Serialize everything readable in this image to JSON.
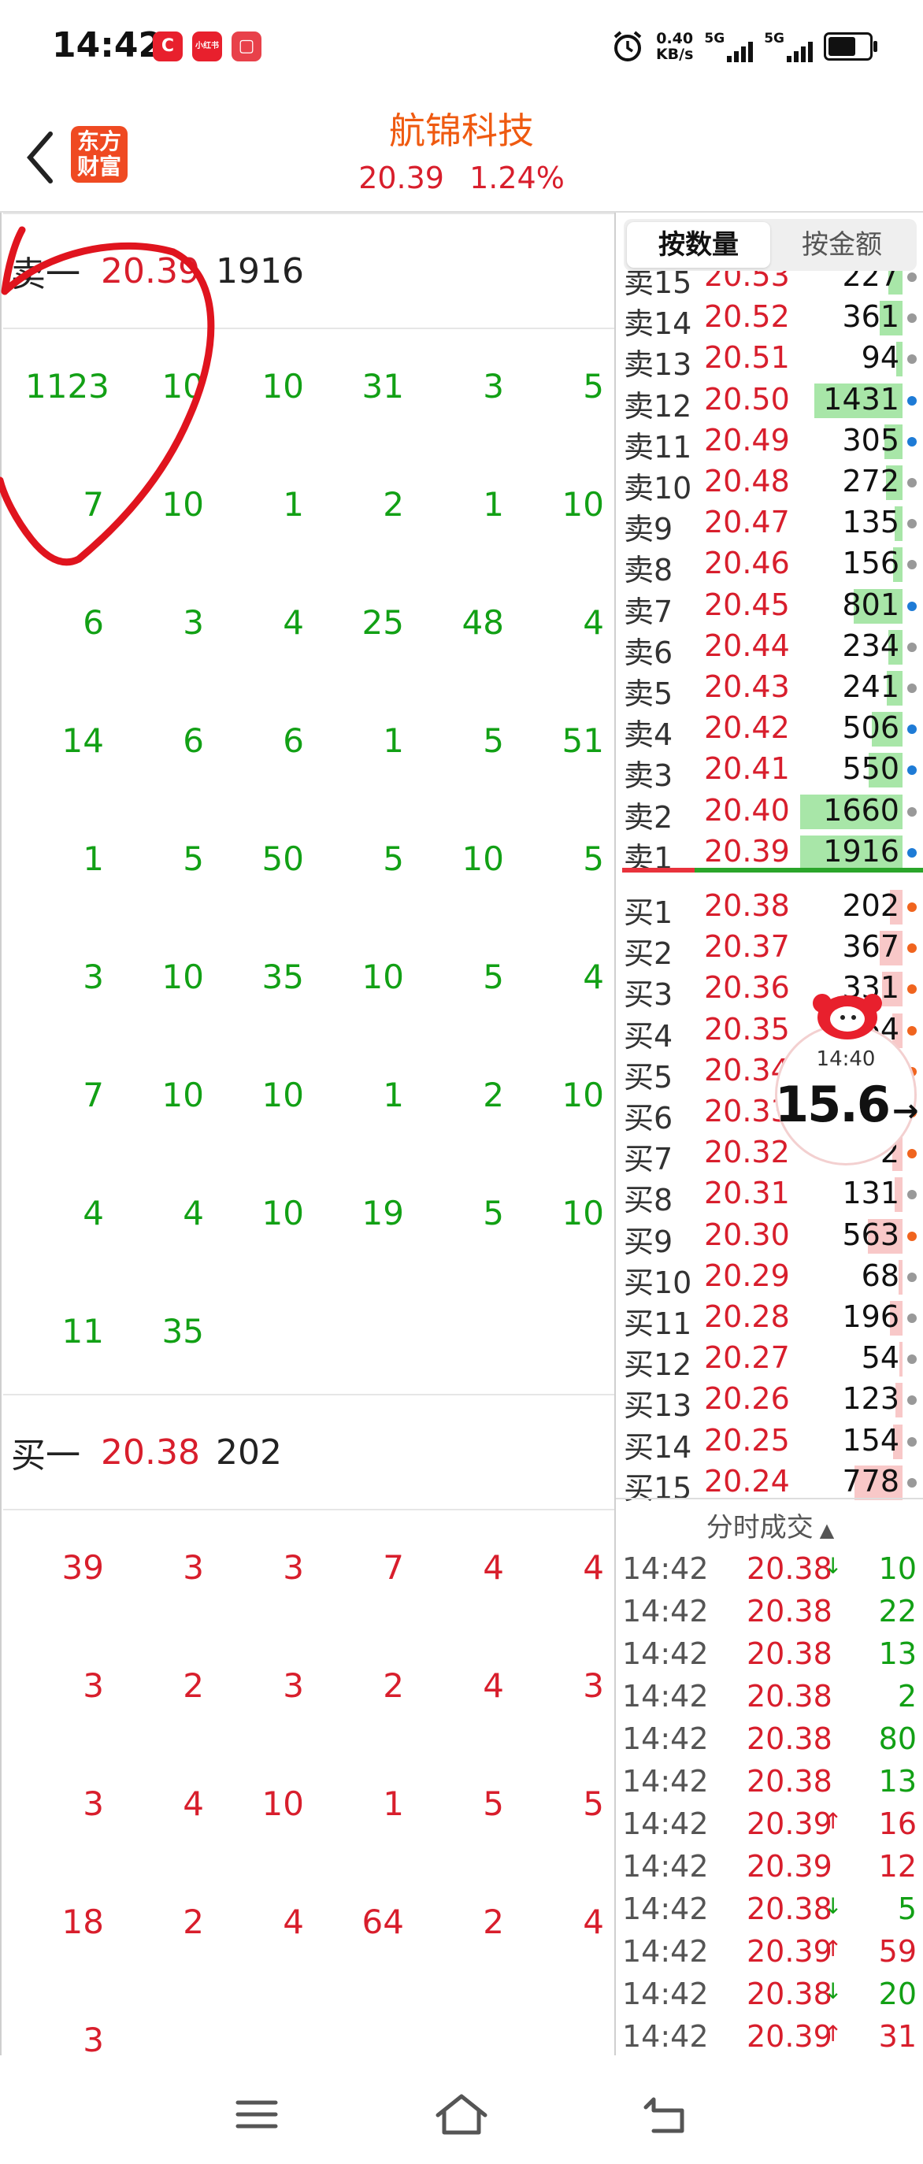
{
  "status_bar": {
    "time": "14:42",
    "apps": [
      {
        "name": "app-c",
        "glyph": "C",
        "color": "#e8202d"
      },
      {
        "name": "app-xiaohongshu",
        "glyph": "小红书",
        "color": "#e8202d"
      },
      {
        "name": "app-red-square",
        "glyph": "▢",
        "color": "#e8414a"
      }
    ],
    "net_speed_value": "0.40",
    "net_speed_unit": "KB/s",
    "signal1": "5G",
    "signal2": "5G"
  },
  "header": {
    "logo_line1": "东方",
    "logo_line2": "财富",
    "stock_name": "航锦科技",
    "price": "20.39",
    "change_pct": "1.24%"
  },
  "sell_section": {
    "label": "卖一",
    "price": "20.39",
    "volume": "1916",
    "orders": [
      [
        "1123",
        "10",
        "10",
        "31",
        "3",
        "5"
      ],
      [
        "7",
        "10",
        "1",
        "2",
        "1",
        "10"
      ],
      [
        "6",
        "3",
        "4",
        "25",
        "48",
        "4"
      ],
      [
        "14",
        "6",
        "6",
        "1",
        "5",
        "51"
      ],
      [
        "1",
        "5",
        "50",
        "5",
        "10",
        "5"
      ],
      [
        "3",
        "10",
        "35",
        "10",
        "5",
        "4"
      ],
      [
        "7",
        "10",
        "10",
        "1",
        "2",
        "10"
      ],
      [
        "4",
        "4",
        "10",
        "19",
        "5",
        "10"
      ],
      [
        "11",
        "35"
      ]
    ]
  },
  "buy_section": {
    "label": "买一",
    "price": "20.38",
    "volume": "202",
    "orders": [
      [
        "39",
        "3",
        "3",
        "7",
        "4",
        "4"
      ],
      [
        "3",
        "2",
        "3",
        "2",
        "4",
        "3"
      ],
      [
        "3",
        "4",
        "10",
        "1",
        "5",
        "5"
      ],
      [
        "18",
        "2",
        "4",
        "64",
        "2",
        "4"
      ],
      [
        "3"
      ]
    ]
  },
  "tabs": {
    "by_quantity": "按数量",
    "by_amount": "按金额"
  },
  "order_book": {
    "sells": [
      {
        "label": "卖15",
        "price": "20.53",
        "volume": "227",
        "bar": 0.14,
        "dot": "#999999"
      },
      {
        "label": "卖14",
        "price": "20.52",
        "volume": "361",
        "bar": 0.22,
        "dot": "#999999"
      },
      {
        "label": "卖13",
        "price": "20.51",
        "volume": "94",
        "bar": 0.06,
        "dot": "#999999"
      },
      {
        "label": "卖12",
        "price": "20.50",
        "volume": "1431",
        "bar": 0.86,
        "dot": "#1e7bd6"
      },
      {
        "label": "卖11",
        "price": "20.49",
        "volume": "305",
        "bar": 0.18,
        "dot": "#1e7bd6"
      },
      {
        "label": "卖10",
        "price": "20.48",
        "volume": "272",
        "bar": 0.16,
        "dot": "#999999"
      },
      {
        "label": "卖9",
        "price": "20.47",
        "volume": "135",
        "bar": 0.08,
        "dot": "#999999"
      },
      {
        "label": "卖8",
        "price": "20.46",
        "volume": "156",
        "bar": 0.09,
        "dot": "#999999"
      },
      {
        "label": "卖7",
        "price": "20.45",
        "volume": "801",
        "bar": 0.48,
        "dot": "#1e7bd6"
      },
      {
        "label": "卖6",
        "price": "20.44",
        "volume": "234",
        "bar": 0.14,
        "dot": "#999999"
      },
      {
        "label": "卖5",
        "price": "20.43",
        "volume": "241",
        "bar": 0.15,
        "dot": "#999999"
      },
      {
        "label": "卖4",
        "price": "20.42",
        "volume": "506",
        "bar": 0.3,
        "dot": "#1e7bd6"
      },
      {
        "label": "卖3",
        "price": "20.41",
        "volume": "550",
        "bar": 0.33,
        "dot": "#1e7bd6"
      },
      {
        "label": "卖2",
        "price": "20.40",
        "volume": "1660",
        "bar": 1.0,
        "dot": "#999999"
      },
      {
        "label": "卖1",
        "price": "20.39",
        "volume": "1916",
        "bar": 1.0,
        "dot": "#1e7bd6"
      }
    ],
    "buys": [
      {
        "label": "买1",
        "price": "20.38",
        "volume": "202",
        "bar": 0.12,
        "dot": "#f0641e"
      },
      {
        "label": "买2",
        "price": "20.37",
        "volume": "367",
        "bar": 0.22,
        "dot": "#f0641e"
      },
      {
        "label": "买3",
        "price": "20.36",
        "volume": "331",
        "bar": 0.2,
        "dot": "#f0641e"
      },
      {
        "label": "买4",
        "price": "20.35",
        "volume": "164",
        "bar": 0.1,
        "dot": "#f0641e"
      },
      {
        "label": "买5",
        "price": "20.34",
        "volume": "",
        "bar": 0.1,
        "dot": "#f0641e"
      },
      {
        "label": "买6",
        "price": "20.33",
        "volume": "",
        "bar": 0.1,
        "dot": "#f0641e"
      },
      {
        "label": "买7",
        "price": "20.32",
        "volume": "2",
        "bar": 0.1,
        "dot": "#f0641e"
      },
      {
        "label": "买8",
        "price": "20.31",
        "volume": "131",
        "bar": 0.08,
        "dot": "#999999"
      },
      {
        "label": "买9",
        "price": "20.30",
        "volume": "563",
        "bar": 0.34,
        "dot": "#f0641e"
      },
      {
        "label": "买10",
        "price": "20.29",
        "volume": "68",
        "bar": 0.04,
        "dot": "#999999"
      },
      {
        "label": "买11",
        "price": "20.28",
        "volume": "196",
        "bar": 0.12,
        "dot": "#999999"
      },
      {
        "label": "买12",
        "price": "20.27",
        "volume": "54",
        "bar": 0.03,
        "dot": "#999999"
      },
      {
        "label": "买13",
        "price": "20.26",
        "volume": "123",
        "bar": 0.07,
        "dot": "#999999"
      },
      {
        "label": "买14",
        "price": "20.25",
        "volume": "154",
        "bar": 0.09,
        "dot": "#999999"
      },
      {
        "label": "买15",
        "price": "20.24",
        "volume": "778",
        "bar": 0.47,
        "dot": "#999999"
      }
    ]
  },
  "ticks": {
    "header": "分时成交",
    "rows": [
      {
        "time": "14:42",
        "price": "20.38",
        "arrow": "down",
        "volume": "10",
        "side": "sell"
      },
      {
        "time": "14:42",
        "price": "20.38",
        "arrow": "",
        "volume": "22",
        "side": "sell"
      },
      {
        "time": "14:42",
        "price": "20.38",
        "arrow": "",
        "volume": "13",
        "side": "sell"
      },
      {
        "time": "14:42",
        "price": "20.38",
        "arrow": "",
        "volume": "2",
        "side": "sell"
      },
      {
        "time": "14:42",
        "price": "20.38",
        "arrow": "",
        "volume": "80",
        "side": "sell"
      },
      {
        "time": "14:42",
        "price": "20.38",
        "arrow": "",
        "volume": "13",
        "side": "sell"
      },
      {
        "time": "14:42",
        "price": "20.39",
        "arrow": "up",
        "volume": "16",
        "side": "buy"
      },
      {
        "time": "14:42",
        "price": "20.39",
        "arrow": "",
        "volume": "12",
        "side": "buy"
      },
      {
        "time": "14:42",
        "price": "20.38",
        "arrow": "down",
        "volume": "5",
        "side": "sell"
      },
      {
        "time": "14:42",
        "price": "20.39",
        "arrow": "up",
        "volume": "59",
        "side": "buy"
      },
      {
        "time": "14:42",
        "price": "20.38",
        "arrow": "down",
        "volume": "20",
        "side": "sell"
      },
      {
        "time": "14:42",
        "price": "20.39",
        "arrow": "up",
        "volume": "31",
        "side": "buy"
      }
    ]
  },
  "float_widget": {
    "time": "14:40",
    "speed": "15.6",
    "arrow": "→"
  },
  "colors": {
    "up_red": "#d81e2c",
    "down_green": "#12a015",
    "sell_bar": "#a8e6a8",
    "buy_bar": "#f8c8c8",
    "accent_orange": "#ef5a10"
  }
}
